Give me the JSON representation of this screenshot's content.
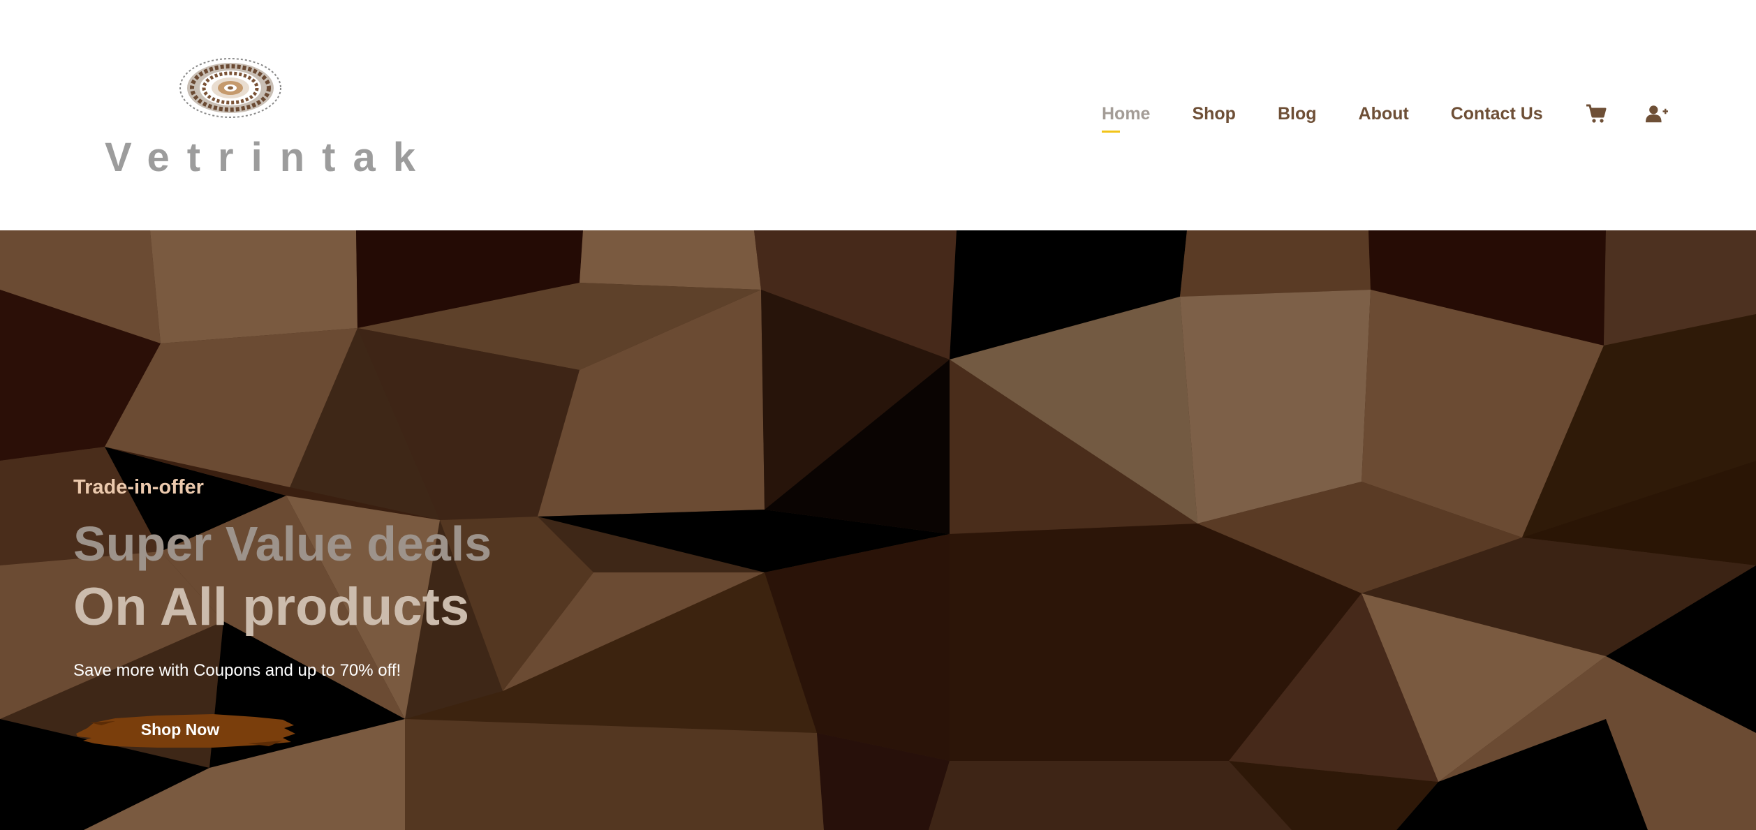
{
  "brand": {
    "logo_text": "Vetrintak",
    "logo_mark_icon": "mandala-icon"
  },
  "nav": {
    "items": [
      {
        "label": "Home",
        "active": true
      },
      {
        "label": "Shop",
        "active": false
      },
      {
        "label": "Blog",
        "active": false
      },
      {
        "label": "About",
        "active": false
      },
      {
        "label": "Contact Us",
        "active": false
      }
    ],
    "icons": [
      "cart-icon",
      "add-user-icon"
    ]
  },
  "hero": {
    "eyebrow": "Trade-in-offer",
    "title_line_1": "Super Value deals",
    "title_line_2": "On All products",
    "subtitle": "Save more with Coupons and up to 70% off!",
    "cta_label": "Shop Now"
  },
  "colors": {
    "nav_text": "#6e4f36",
    "nav_active": "#a39c96",
    "nav_underline": "#f2c419",
    "hero_background": "#3e2717",
    "cta_background": "#7a3e0c"
  }
}
